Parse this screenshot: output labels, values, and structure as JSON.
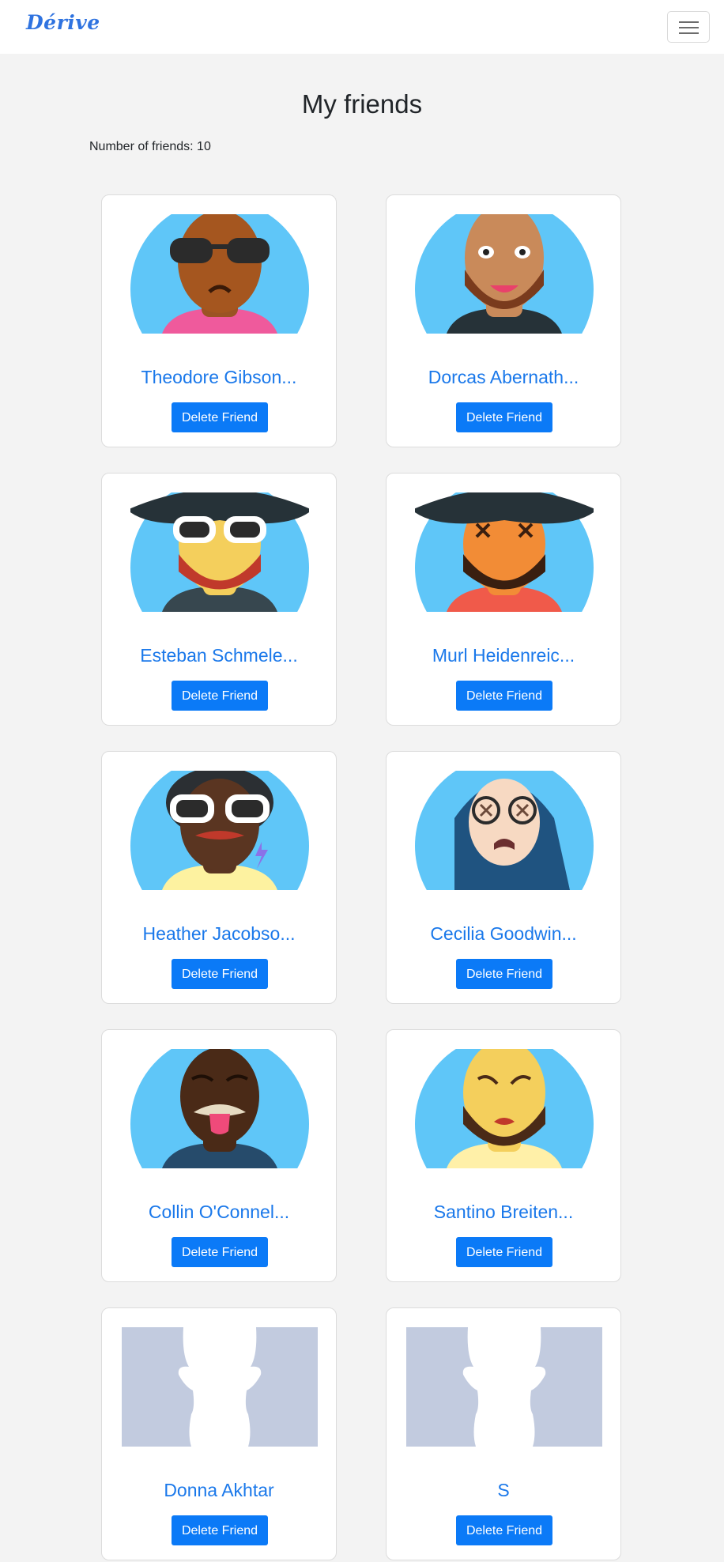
{
  "navbar": {
    "brand": "Dérive",
    "menu_icon": "hamburger-menu-icon"
  },
  "page": {
    "title": "My friends",
    "count_text": "Number of friends: 10"
  },
  "friends": [
    {
      "name": "Theodore Gibson...",
      "delete_label": "Delete Friend",
      "avatar": "cartoon-avatar"
    },
    {
      "name": "Dorcas Abernath...",
      "delete_label": "Delete Friend",
      "avatar": "cartoon-avatar"
    },
    {
      "name": "Esteban Schmele...",
      "delete_label": "Delete Friend",
      "avatar": "cartoon-avatar"
    },
    {
      "name": "Murl Heidenreic...",
      "delete_label": "Delete Friend",
      "avatar": "cartoon-avatar"
    },
    {
      "name": "Heather Jacobso...",
      "delete_label": "Delete Friend",
      "avatar": "cartoon-avatar"
    },
    {
      "name": "Cecilia Goodwin...",
      "delete_label": "Delete Friend",
      "avatar": "cartoon-avatar"
    },
    {
      "name": "Collin O'Connel...",
      "delete_label": "Delete Friend",
      "avatar": "cartoon-avatar"
    },
    {
      "name": "Santino Breiten...",
      "delete_label": "Delete Friend",
      "avatar": "cartoon-avatar"
    },
    {
      "name": "Donna Akhtar",
      "delete_label": "Delete Friend",
      "avatar": "default-silhouette"
    },
    {
      "name": "S",
      "delete_label": "Delete Friend",
      "avatar": "default-silhouette"
    }
  ],
  "colors": {
    "accent": "#0b7af7",
    "link": "#1a78ea",
    "avatar_bg": "#5fc6f8",
    "placeholder_bg": "#c2cbdf"
  }
}
